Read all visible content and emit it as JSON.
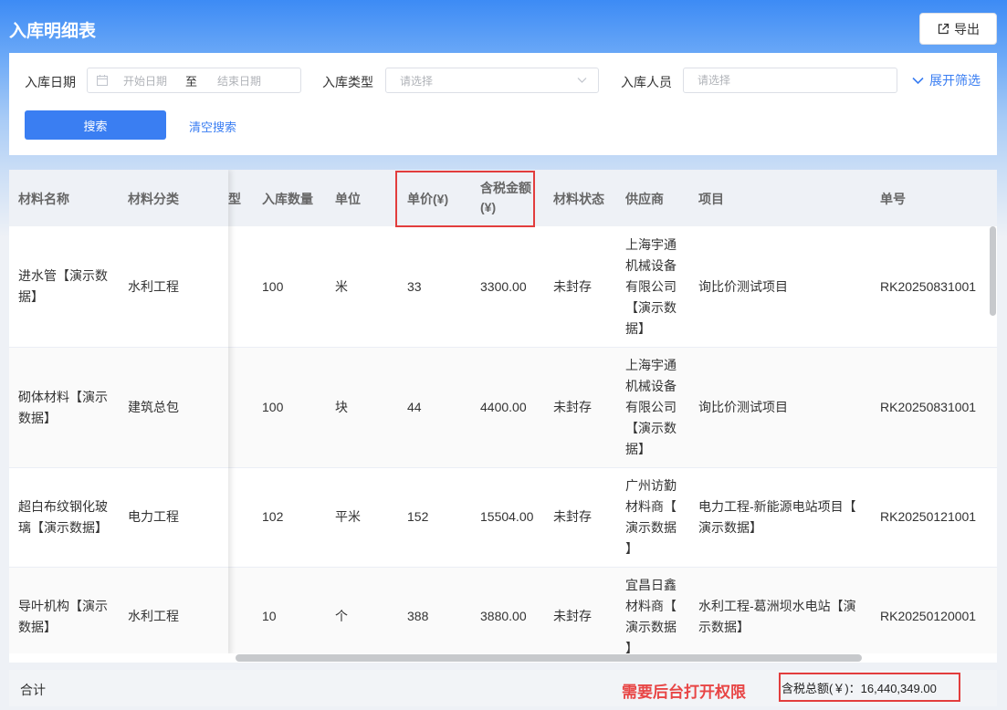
{
  "header": {
    "title": "入库明细表",
    "export_label": "导出"
  },
  "filters": {
    "date_label": "入库日期",
    "date_start_placeholder": "开始日期",
    "date_separator": "至",
    "date_end_placeholder": "结束日期",
    "type_label": "入库类型",
    "type_placeholder": "请选择",
    "person_label": "入库人员",
    "person_placeholder": "请选择",
    "expand_label": "展开筛选",
    "search_label": "搜索",
    "clear_label": "清空搜索"
  },
  "table": {
    "columns": {
      "material_name": "材料名称",
      "material_category": "材料分类",
      "type_partial": "型",
      "quantity": "入库数量",
      "unit": "单位",
      "unit_price": "单价(¥)",
      "amount_line1": "含税金额",
      "amount_line2": "(¥)",
      "status": "材料状态",
      "supplier": "供应商",
      "project": "项目",
      "order_no": "单号"
    },
    "rows": [
      {
        "name": [
          "进水管【演示数",
          "据】"
        ],
        "category": "水利工程",
        "quantity": "100",
        "unit": "米",
        "unit_price": "33",
        "amount": "3300.00",
        "status": "未封存",
        "supplier": [
          "上海宇通",
          "机械设备",
          "有限公司",
          "【演示数",
          "据】"
        ],
        "project": [
          "询比价测试项目"
        ],
        "order_no": "RK20250831001"
      },
      {
        "name": [
          "砌体材料【演示",
          "数据】"
        ],
        "category": "建筑总包",
        "quantity": "100",
        "unit": "块",
        "unit_price": "44",
        "amount": "4400.00",
        "status": "未封存",
        "supplier": [
          "上海宇通",
          "机械设备",
          "有限公司",
          "【演示数",
          "据】"
        ],
        "project": [
          "询比价测试项目"
        ],
        "order_no": "RK20250831001"
      },
      {
        "name": [
          "超白布纹钢化玻",
          "璃【演示数据】"
        ],
        "category": "电力工程",
        "quantity": "102",
        "unit": "平米",
        "unit_price": "152",
        "amount": "15504.00",
        "status": "未封存",
        "supplier": [
          "广州访勤",
          "材料商【",
          "演示数据",
          "】"
        ],
        "project": [
          "电力工程-新能源电站项目【",
          "演示数据】"
        ],
        "order_no": "RK20250121001"
      },
      {
        "name": [
          "导叶机构【演示",
          "数据】"
        ],
        "category": "水利工程",
        "quantity": "10",
        "unit": "个",
        "unit_price": "388",
        "amount": "3880.00",
        "status": "未封存",
        "supplier": [
          "宜昌日鑫",
          "材料商【",
          "演示数据",
          "】"
        ],
        "project": [
          "水利工程-葛洲坝水电站【演",
          "示数据】"
        ],
        "order_no": "RK20250120001"
      }
    ]
  },
  "footer": {
    "total_label": "合计",
    "warning": "需要后台打开权限",
    "total_amount": "含税总额(￥)：16,440,349.00"
  },
  "colors": {
    "primary": "#3a7ef2",
    "warning_red": "#e84545",
    "annotation_border": "#e23d3d",
    "header_gradient_top": "#3d8bf5"
  },
  "icons": {
    "export": "export-icon",
    "calendar": "calendar-icon",
    "dropdown": "chevron-down-icon",
    "expand": "chevron-down-icon"
  }
}
